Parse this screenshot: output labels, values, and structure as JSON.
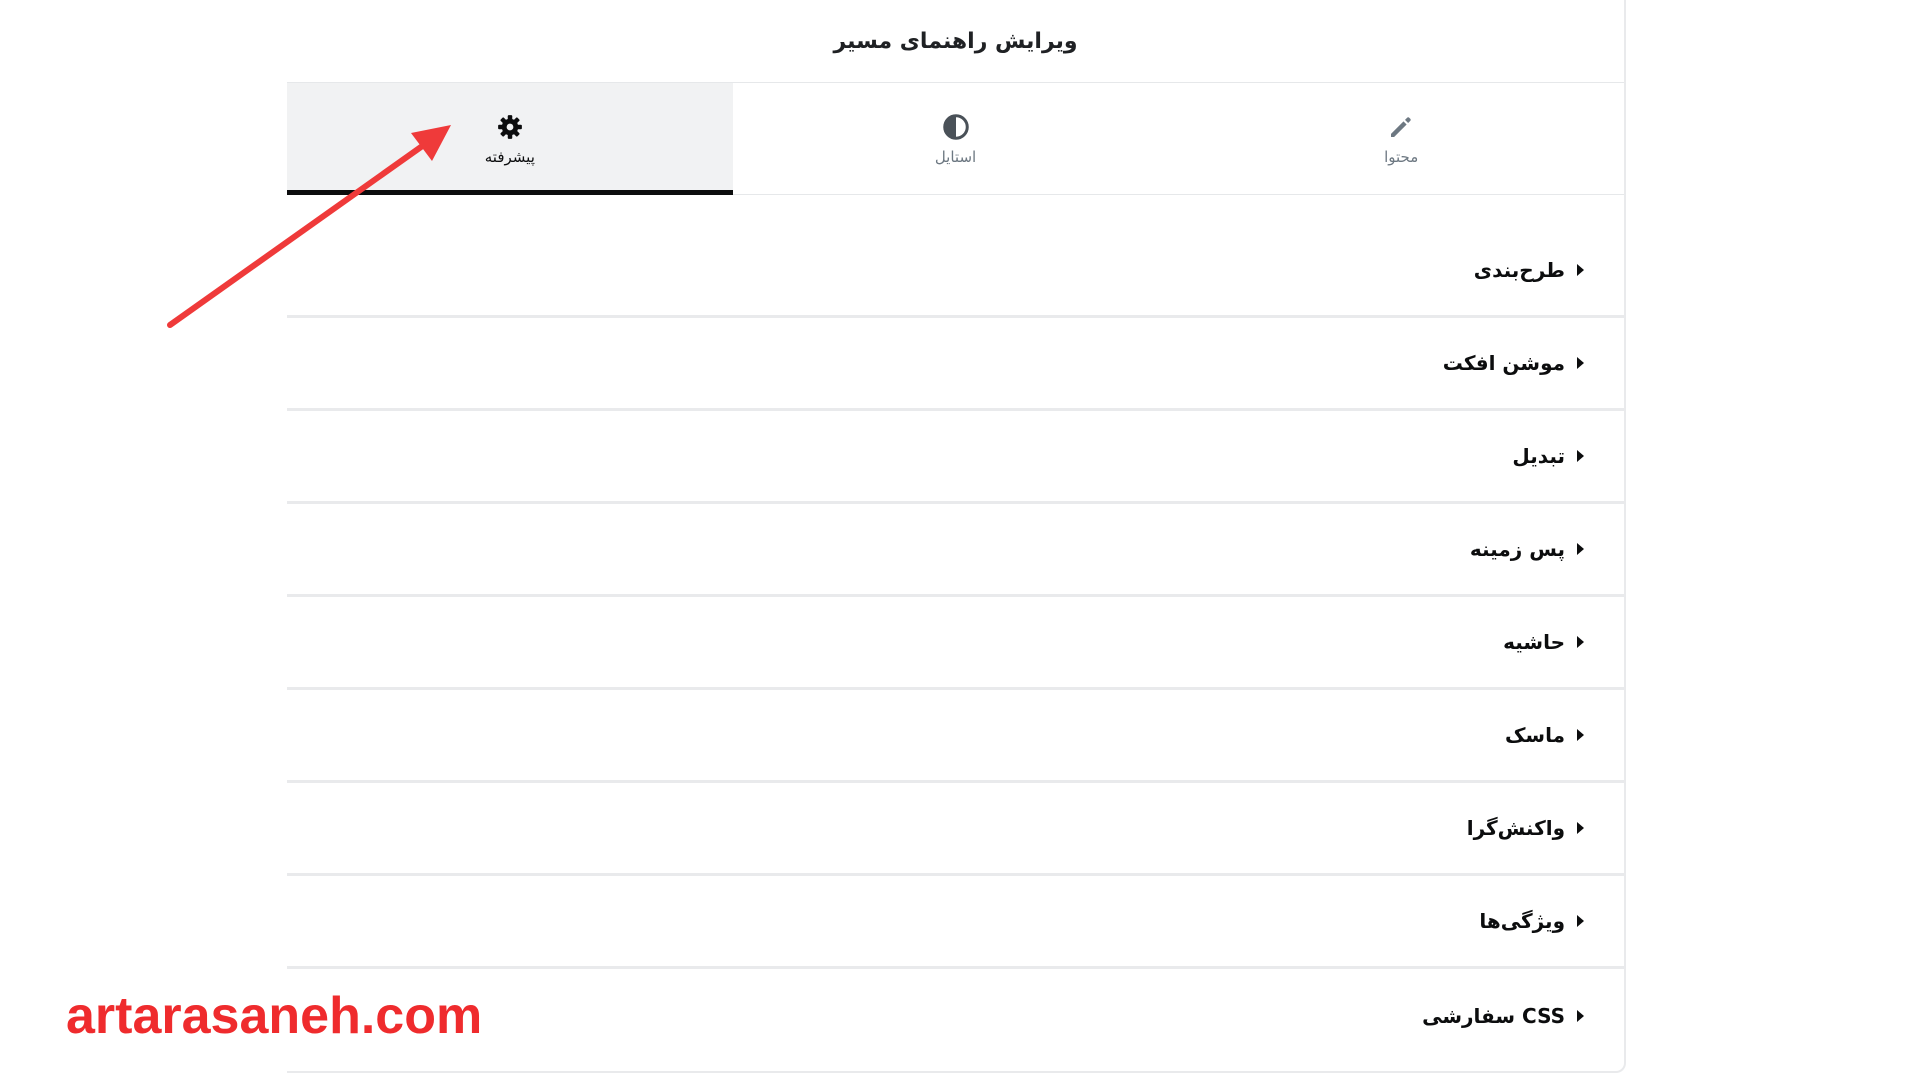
{
  "panel": {
    "title": "ویرایش راهنمای مسیر"
  },
  "tabs": [
    {
      "label": "محتوا",
      "icon": "pencil-icon",
      "active": false
    },
    {
      "label": "استایل",
      "icon": "half-circle-icon",
      "active": false
    },
    {
      "label": "پیشرفته",
      "icon": "gear-icon",
      "active": true
    }
  ],
  "sections": [
    {
      "label": "طرح‌بندی"
    },
    {
      "label": "موشن افکت"
    },
    {
      "label": "تبدیل"
    },
    {
      "label": "پس زمینه"
    },
    {
      "label": "حاشیه"
    },
    {
      "label": "ماسک"
    },
    {
      "label": "واکنش‌گرا"
    },
    {
      "label": "ویژگی‌ها"
    },
    {
      "label": "CSS سفارشی"
    }
  ],
  "watermark": "artarasaneh.com",
  "colors": {
    "annotation_arrow": "#ef3a3a",
    "active_tab_underline": "#0c0d0e",
    "active_tab_bg": "#f1f2f3",
    "watermark": "#ef2b2d"
  }
}
